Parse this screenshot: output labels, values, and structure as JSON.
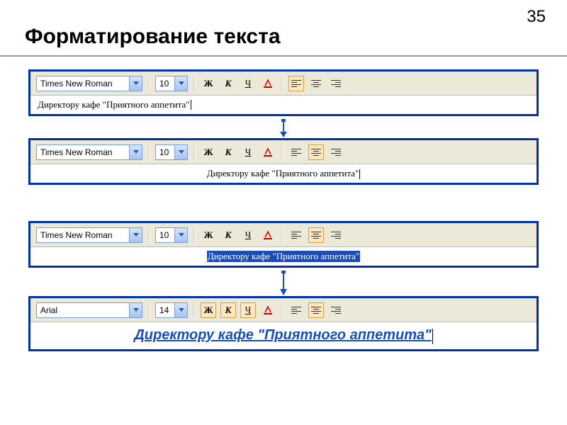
{
  "page_number": "35",
  "title": "Форматирование текста",
  "examples": [
    {
      "font": "Times New Roman",
      "size": "10",
      "bold_label": "Ж",
      "italic_label": "К",
      "underline_label": "Ч",
      "text": "Директору кафе \"Приятного аппетита\"",
      "align": "left",
      "selected": false,
      "formatted": false,
      "active_align": "left",
      "active_styles": []
    },
    {
      "font": "Times New Roman",
      "size": "10",
      "bold_label": "Ж",
      "italic_label": "К",
      "underline_label": "Ч",
      "text": "Директору кафе \"Приятного аппетита\"",
      "align": "center",
      "selected": false,
      "formatted": false,
      "active_align": "center",
      "active_styles": []
    },
    {
      "font": "Times New Roman",
      "size": "10",
      "bold_label": "Ж",
      "italic_label": "К",
      "underline_label": "Ч",
      "text": "Директору кафе \"Приятного аппетита\"",
      "align": "center",
      "selected": true,
      "formatted": false,
      "active_align": "center",
      "active_styles": []
    },
    {
      "font": "Arial",
      "size": "14",
      "bold_label": "Ж",
      "italic_label": "К",
      "underline_label": "Ч",
      "text": "Директору кафе \"Приятного аппетита\"",
      "align": "center",
      "selected": false,
      "formatted": true,
      "active_align": "center",
      "active_styles": [
        "bold",
        "italic",
        "underline"
      ]
    }
  ]
}
